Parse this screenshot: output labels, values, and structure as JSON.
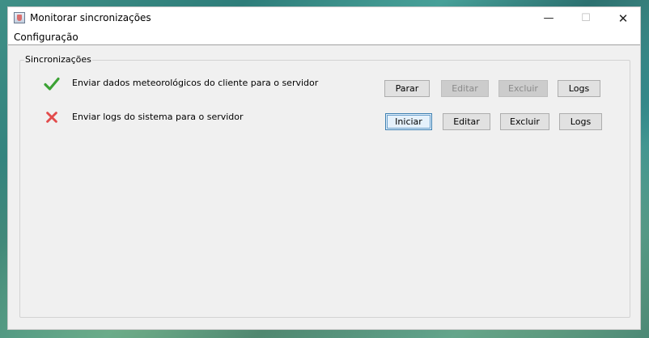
{
  "window": {
    "title": "Monitorar sincronizações",
    "controls": {
      "minimize": "—",
      "maximize": "☐",
      "close": "✕"
    }
  },
  "menubar": {
    "items": [
      {
        "label": "Configuração"
      }
    ]
  },
  "group": {
    "title": "Sincronizações"
  },
  "syncs": [
    {
      "status": "ok",
      "status_icon": "checkmark-icon",
      "status_color": "#3ca235",
      "label": "Enviar dados meteorológicos do cliente para o servidor",
      "buttons": [
        {
          "label": "Parar",
          "enabled": true
        },
        {
          "label": "Editar",
          "enabled": false
        },
        {
          "label": "Excluir",
          "enabled": false
        },
        {
          "label": "Logs",
          "enabled": true
        }
      ]
    },
    {
      "status": "stopped",
      "status_icon": "cross-icon",
      "status_color": "#e24b4b",
      "label": "Enviar logs do sistema para o servidor",
      "buttons": [
        {
          "label": "Iniciar",
          "enabled": true,
          "focused": true
        },
        {
          "label": "Editar",
          "enabled": true
        },
        {
          "label": "Excluir",
          "enabled": true
        },
        {
          "label": "Logs",
          "enabled": true
        }
      ]
    }
  ]
}
